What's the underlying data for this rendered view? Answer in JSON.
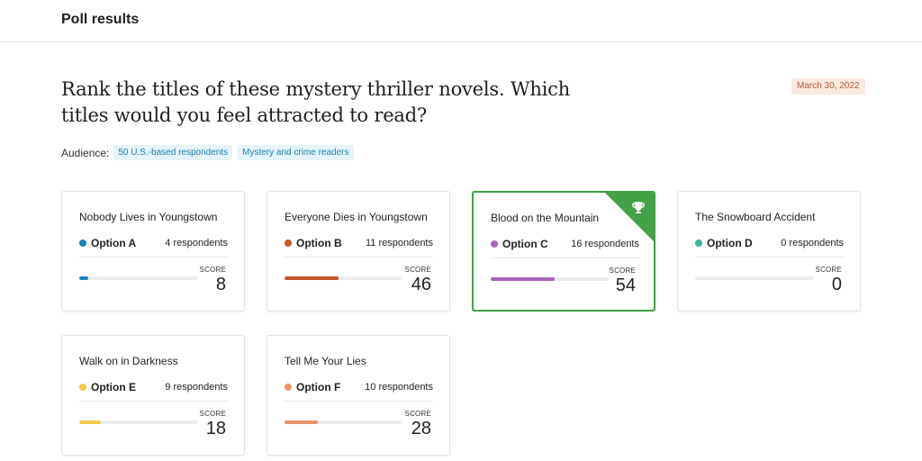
{
  "header": {
    "title": "Poll results"
  },
  "question": "Rank the titles of these mystery thriller novels. Which titles would you feel attracted to read?",
  "date": "March 30, 2022",
  "audience": {
    "label": "Audience:",
    "chips": [
      "50 U.S.-based respondents",
      "Mystery and crime readers"
    ]
  },
  "score_label": "SCORE",
  "colors": {
    "winner": "#43a047"
  },
  "options": [
    {
      "title": "Nobody Lives in Youngstown",
      "option": "Option A",
      "respondents": "4 respondents",
      "score": 8,
      "color": "#1b84c5"
    },
    {
      "title": "Everyone Dies in Youngstown",
      "option": "Option B",
      "respondents": "11 respondents",
      "score": 46,
      "color": "#c9532b"
    },
    {
      "title": "Blood on the Mountain",
      "option": "Option C",
      "respondents": "16 respondents",
      "score": 54,
      "color": "#a865b8",
      "winner": true
    },
    {
      "title": "The Snowboard Accident",
      "option": "Option D",
      "respondents": "0 respondents",
      "score": 0,
      "color": "#3fb39a"
    },
    {
      "title": "Walk on in Darkness",
      "option": "Option E",
      "respondents": "9 respondents",
      "score": 18,
      "color": "#f2c94c"
    },
    {
      "title": "Tell Me Your Lies",
      "option": "Option F",
      "respondents": "10 respondents",
      "score": 28,
      "color": "#e8956b"
    }
  ]
}
